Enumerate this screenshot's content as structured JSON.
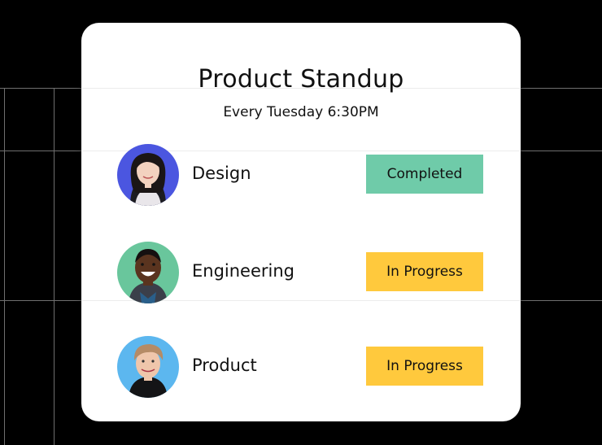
{
  "card": {
    "title": "Product Standup",
    "subtitle": "Every Tuesday 6:30PM"
  },
  "teams": [
    {
      "name": "Design",
      "status": "Completed",
      "status_color": "#6fcba9",
      "avatar_bg": "#4b56e0",
      "avatar_icon": "person-avatar-icon"
    },
    {
      "name": "Engineering",
      "status": "In Progress",
      "status_color": "#ffc93d",
      "avatar_bg": "#69c69c",
      "avatar_icon": "person-avatar-icon"
    },
    {
      "name": "Product",
      "status": "In Progress",
      "status_color": "#ffc93d",
      "avatar_bg": "#5cb7ef",
      "avatar_icon": "person-avatar-icon"
    }
  ]
}
